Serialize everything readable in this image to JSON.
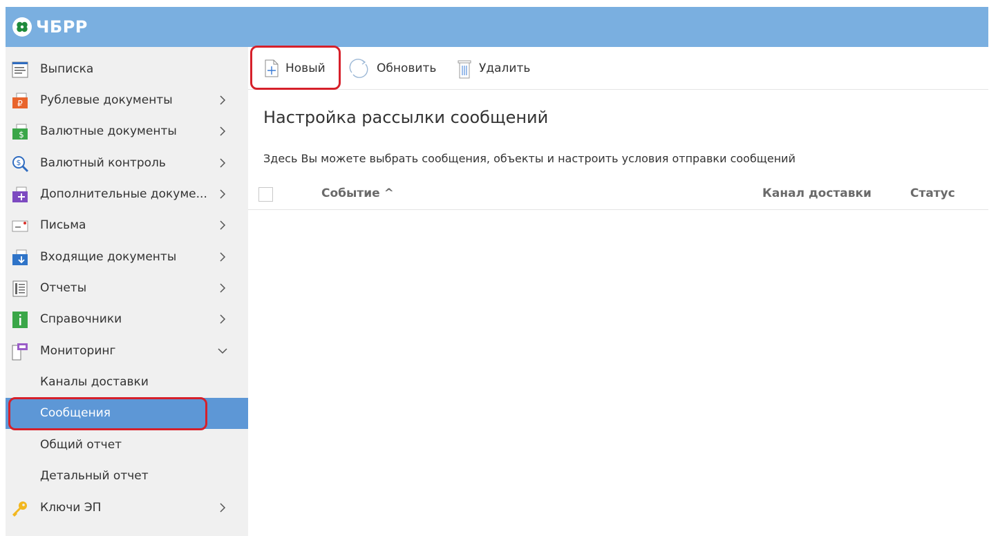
{
  "app": {
    "logo_text": "ЧБРР"
  },
  "colors": {
    "header": "#7aafe0",
    "active": "#5d97d6",
    "highlight": "#d6202a"
  },
  "sidebar": {
    "items": [
      {
        "label": "Выписка",
        "icon": "statement-icon"
      },
      {
        "label": "Рублевые документы",
        "icon": "ruble-documents-icon"
      },
      {
        "label": "Валютные документы",
        "icon": "currency-documents-icon"
      },
      {
        "label": "Валютный контроль",
        "icon": "currency-control-icon"
      },
      {
        "label": "Дополнительные докуме...",
        "icon": "additional-documents-icon"
      },
      {
        "label": "Письма",
        "icon": "letters-icon"
      },
      {
        "label": "Входящие документы",
        "icon": "incoming-documents-icon"
      },
      {
        "label": "Отчеты",
        "icon": "reports-icon"
      },
      {
        "label": "Справочники",
        "icon": "directories-icon"
      },
      {
        "label": "Мониторинг",
        "icon": "monitoring-icon"
      }
    ],
    "monitoring_sub": [
      {
        "label": "Каналы доставки"
      },
      {
        "label": "Сообщения"
      },
      {
        "label": "Общий отчет"
      },
      {
        "label": "Детальный отчет"
      }
    ],
    "keys": {
      "label": "Ключи ЭП",
      "icon": "key-icon"
    }
  },
  "toolbar": {
    "new_label": "Новый",
    "refresh_label": "Обновить",
    "delete_label": "Удалить"
  },
  "main": {
    "title": "Настройка рассылки сообщений",
    "description": "Здесь Вы можете выбрать сообщения, объекты и настроить условия отправки сообщений",
    "table": {
      "columns": [
        "Событие ^",
        "Канал доставки",
        "Статус"
      ]
    }
  }
}
